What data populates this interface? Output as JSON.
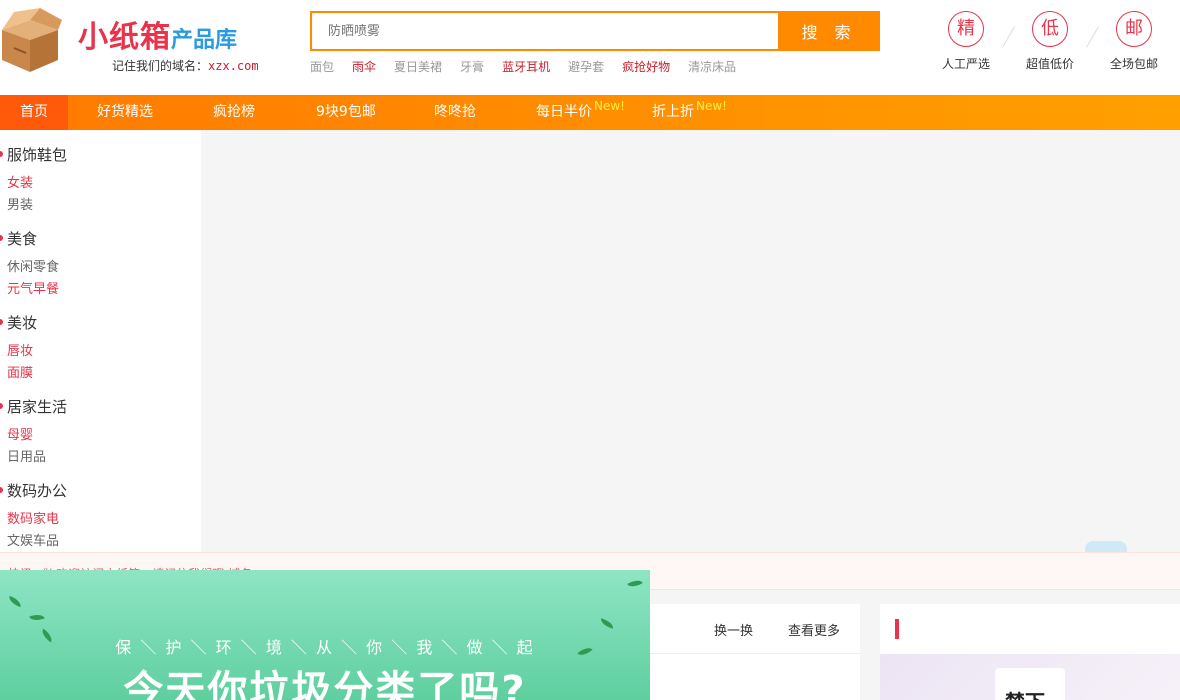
{
  "header": {
    "logo_main": "小纸箱",
    "logo_sub": "产品库",
    "domain_prefix": "记住我们的域名：",
    "domain": "xzx.com"
  },
  "search": {
    "placeholder": "防晒喷雾",
    "button_label": "搜 索",
    "hot_words": [
      {
        "text": "面包",
        "hot": false
      },
      {
        "text": "雨伞",
        "hot": true
      },
      {
        "text": "夏日美裙",
        "hot": false
      },
      {
        "text": "牙膏",
        "hot": false
      },
      {
        "text": "蓝牙耳机",
        "hot": true
      },
      {
        "text": "避孕套",
        "hot": false
      },
      {
        "text": "疯抢好物",
        "hot": true
      },
      {
        "text": "清凉床品",
        "hot": false
      }
    ]
  },
  "promises": [
    {
      "char": "精",
      "label": "人工严选"
    },
    {
      "char": "低",
      "label": "超值低价"
    },
    {
      "char": "邮",
      "label": "全场包邮"
    }
  ],
  "nav": {
    "items": [
      {
        "label": "首页",
        "active": true,
        "badge": ""
      },
      {
        "label": "好货精选",
        "active": false,
        "badge": ""
      },
      {
        "label": "疯抢榜",
        "active": false,
        "badge": ""
      },
      {
        "label": "9块9包邮",
        "active": false,
        "badge": ""
      },
      {
        "label": "咚咚抢",
        "active": false,
        "badge": ""
      },
      {
        "label": "每日半价",
        "active": false,
        "badge": "New!"
      },
      {
        "label": "折上折",
        "active": false,
        "badge": "New!"
      }
    ]
  },
  "categories": [
    {
      "title": "服饰鞋包",
      "subs": [
        {
          "text": "女装",
          "red": true
        },
        {
          "text": "男装",
          "red": false
        }
      ]
    },
    {
      "title": "美食",
      "subs": [
        {
          "text": "休闲零食",
          "red": false
        },
        {
          "text": "元气早餐",
          "red": true
        }
      ]
    },
    {
      "title": "美妆",
      "subs": [
        {
          "text": "唇妆",
          "red": true
        },
        {
          "text": "面膜",
          "red": true
        }
      ]
    },
    {
      "title": "居家生活",
      "subs": [
        {
          "text": "母婴",
          "red": true
        },
        {
          "text": "日用品",
          "red": false
        }
      ]
    },
    {
      "title": "数码办公",
      "subs": [
        {
          "text": "数码家电",
          "red": true
        },
        {
          "text": "文娱车品",
          "red": false
        }
      ]
    }
  ],
  "notice": {
    "text": "快讯 《( 欢迎访问小纸箱，请记住我们哦 域名"
  },
  "panel": {
    "refresh_label": "换一换",
    "more_label": "查看更多"
  },
  "right_panel": {
    "card_text": "楚下"
  },
  "popup": {
    "subtitle": "保 ＼ 护 ＼ 环 ＼ 境  ＼  从 ＼ 你 ＼ 我 ＼ 做 ＼ 起",
    "title": "今天你垃圾分类了吗?"
  },
  "colors": {
    "brand_red": "#e8334a",
    "brand_blue": "#2a9be0",
    "orange": "#ff8a00",
    "nav_active": "#ff5a0a",
    "new_badge": "#ffef3a",
    "popup_green": "#5fcf9f"
  }
}
